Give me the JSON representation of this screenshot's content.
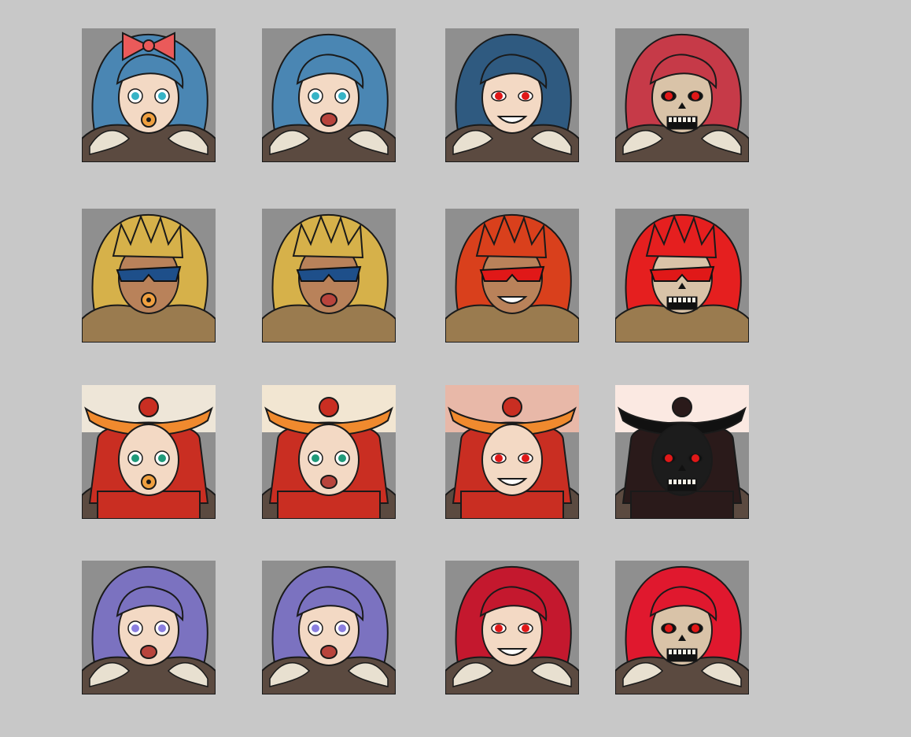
{
  "sheet": {
    "background_color": "#c8c8c8",
    "tile_background_color": "#8f8f8f"
  },
  "characters": [
    {
      "name": "blue-haired-girl",
      "hair_color": "#3f76a1",
      "stages": [
        {
          "stage": "baby",
          "icon": "baby-girl-with-bow-and-pacifier-portrait",
          "hair_color": "#4a86b3",
          "eye_color": "#35b3c6"
        },
        {
          "stage": "adult",
          "icon": "blue-haired-woman-shouting-portrait",
          "hair_color": "#4a86b3",
          "eye_color": "#35b3c6"
        },
        {
          "stage": "evil",
          "icon": "blue-haired-woman-red-eyes-grinning-portrait",
          "hair_color": "#2f5a80",
          "eye_color": "#e01818"
        },
        {
          "stage": "undead",
          "icon": "red-haired-skull-woman-portrait",
          "hair_color": "#c63a48",
          "eye_color": "#e01818"
        }
      ]
    },
    {
      "name": "sunglasses-brawler",
      "hair_color": "#d8b040",
      "stages": [
        {
          "stage": "baby",
          "icon": "blonde-baby-with-sunglasses-portrait",
          "hair_color": "#d6b14a",
          "eye_color": "#1e4f8a"
        },
        {
          "stage": "adult",
          "icon": "blonde-man-with-sunglasses-yelling-portrait",
          "hair_color": "#d6b14a",
          "eye_color": "#1e4f8a"
        },
        {
          "stage": "evil",
          "icon": "red-haired-man-with-red-glasses-roaring-portrait",
          "hair_color": "#d9401c",
          "eye_color": "#e01818"
        },
        {
          "stage": "undead",
          "icon": "red-haired-skull-man-with-red-glasses-portrait",
          "hair_color": "#e51f1f",
          "eye_color": "#e01818"
        }
      ]
    },
    {
      "name": "samurai",
      "hair_color": "#f2e6d2",
      "stages": [
        {
          "stage": "baby",
          "icon": "baby-samurai-with-pacifier-portrait",
          "hair_color": "#eee6d8",
          "eye_color": "#1f9a7a"
        },
        {
          "stage": "adult",
          "icon": "samurai-gritting-teeth-portrait",
          "hair_color": "#f2e6d2",
          "eye_color": "#1f9a7a"
        },
        {
          "stage": "evil",
          "icon": "samurai-red-eyes-grinning-portrait",
          "hair_color": "#e8b8a8",
          "eye_color": "#e01818"
        },
        {
          "stage": "undead",
          "icon": "black-oni-mask-samurai-portrait",
          "hair_color": "#fbe9e2",
          "eye_color": "#e01818"
        }
      ]
    },
    {
      "name": "purple-haired-girl",
      "hair_color": "#7b72c0",
      "stages": [
        {
          "stage": "child",
          "icon": "purple-haired-girl-surprised-portrait",
          "hair_color": "#7b72c0",
          "eye_color": "#8b7fe0"
        },
        {
          "stage": "adult",
          "icon": "purple-haired-woman-smirking-portrait",
          "hair_color": "#7b72c0",
          "eye_color": "#8b7fe0"
        },
        {
          "stage": "evil",
          "icon": "crimson-haired-woman-fangs-portrait",
          "hair_color": "#c4182e",
          "eye_color": "#e01818"
        },
        {
          "stage": "undead",
          "icon": "crimson-haired-skull-woman-portrait",
          "hair_color": "#e0182e",
          "eye_color": "#e01818"
        }
      ]
    }
  ]
}
